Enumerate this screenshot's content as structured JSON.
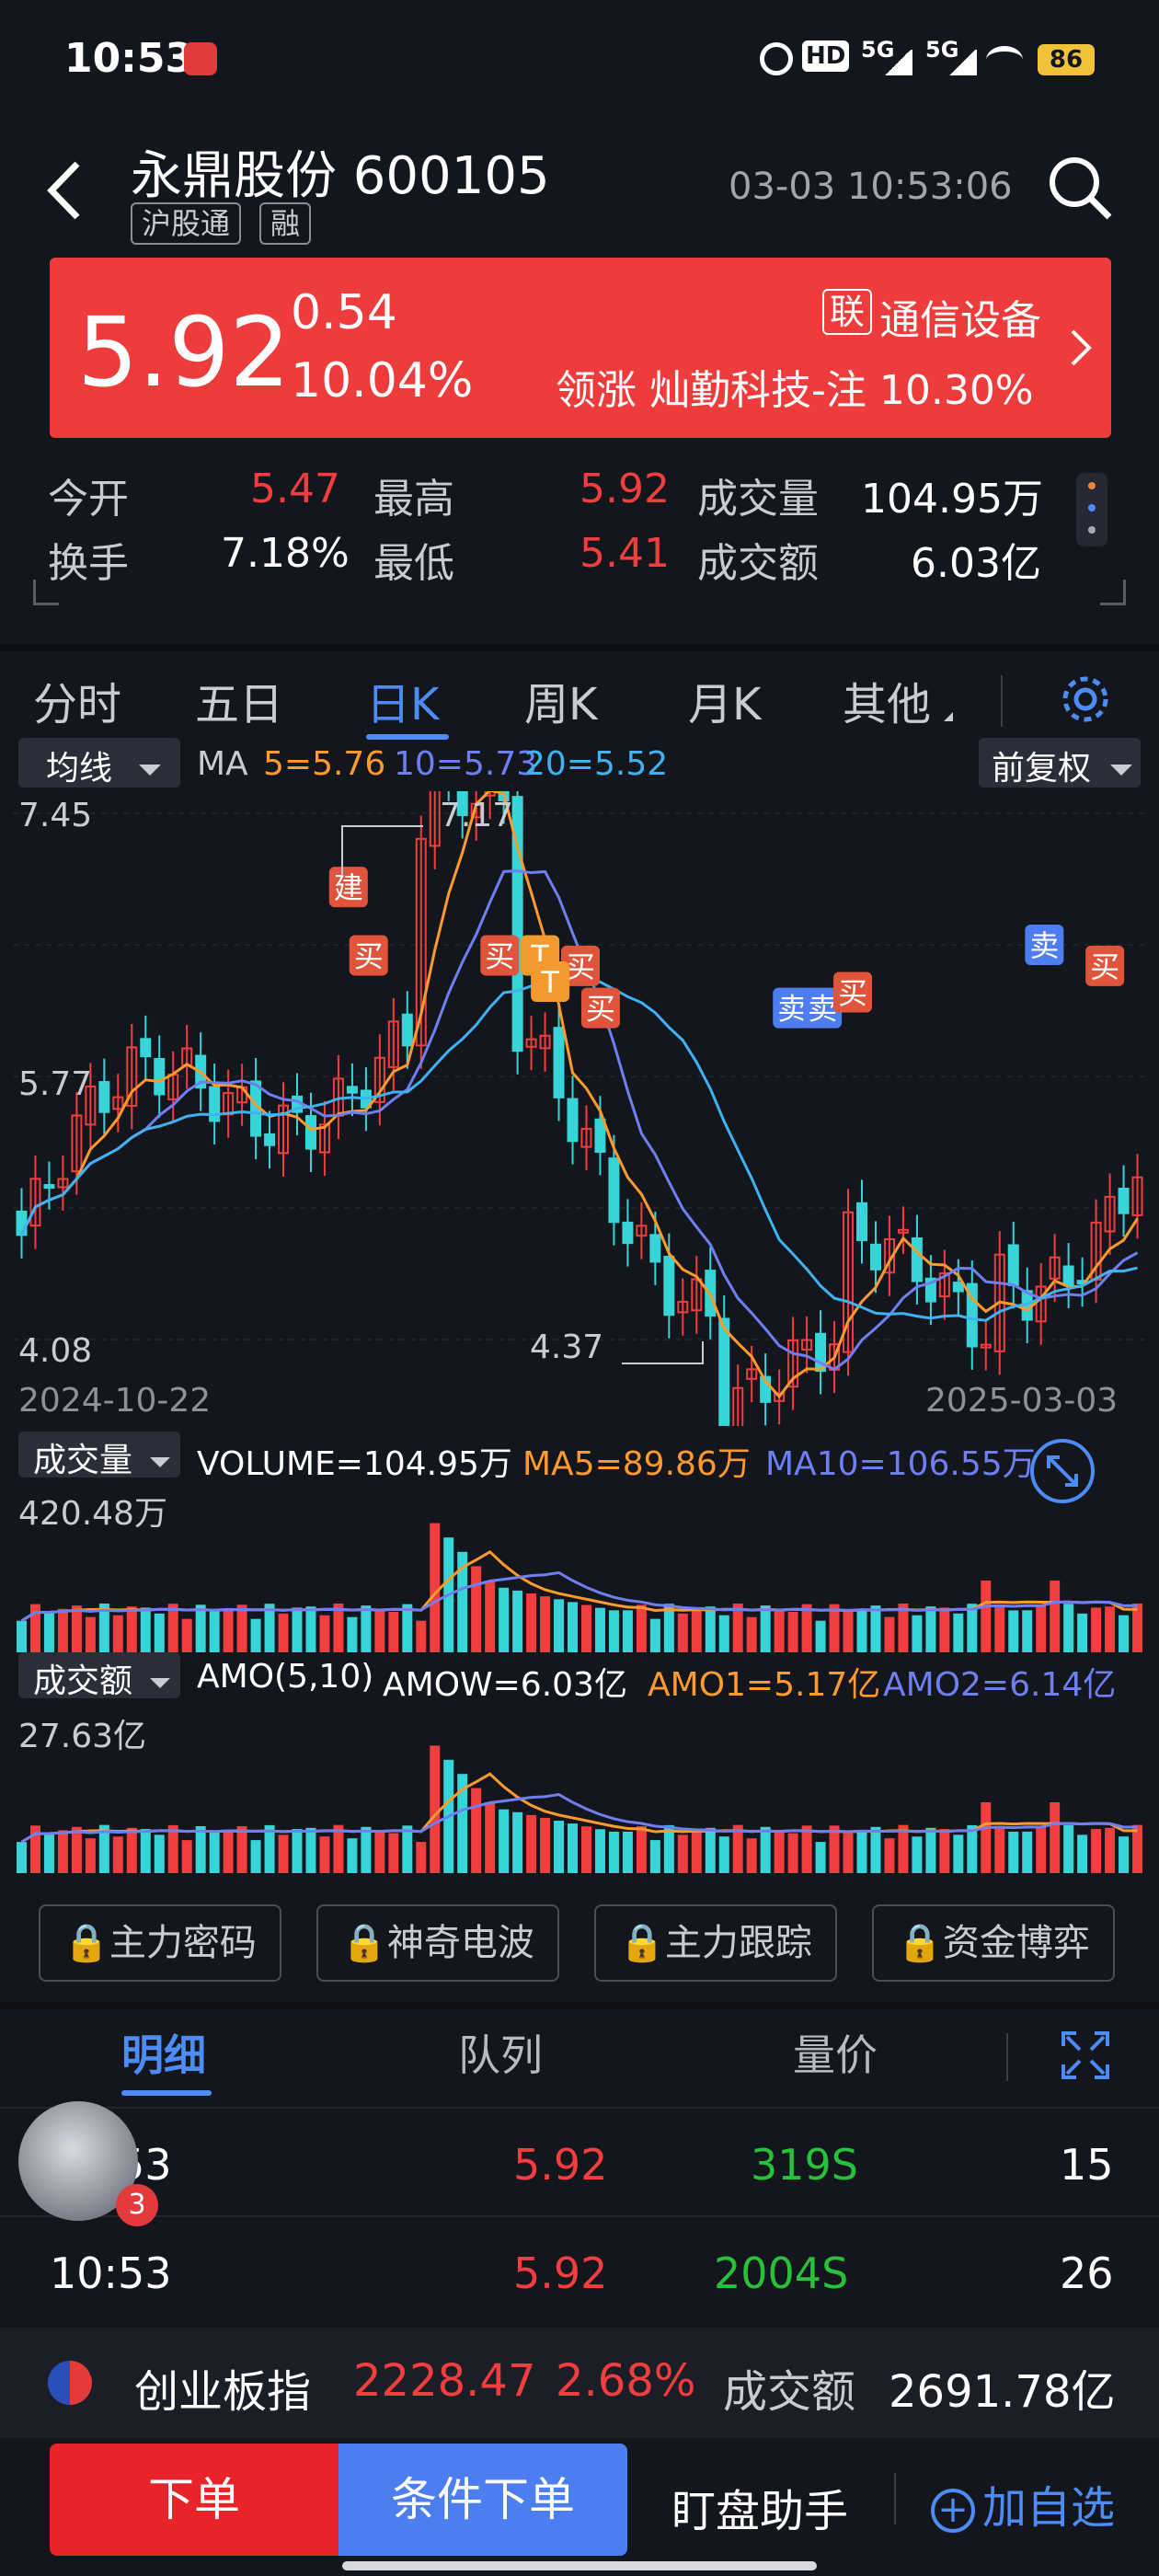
{
  "status": {
    "time": "10:53",
    "battery": "86",
    "net1": "5G",
    "net2": "5G"
  },
  "header": {
    "title": "永鼎股份 600105",
    "tag1": "沪股通",
    "tag2": "融",
    "datetime": "03-03 10:53:06"
  },
  "quote": {
    "price": "5.92",
    "change": "0.54",
    "change_pct": "10.04%",
    "sector_tag": "联",
    "sector": "通信设备",
    "leader": "领涨 灿勤科技-注 10.30%"
  },
  "stats": {
    "open_label": "今开",
    "open": "5.47",
    "high_label": "最高",
    "high": "5.92",
    "vol_label": "成交量",
    "vol": "104.95万",
    "turnover_label": "换手",
    "turnover": "7.18%",
    "low_label": "最低",
    "low": "5.41",
    "amt_label": "成交额",
    "amt": "6.03亿"
  },
  "tabs": [
    "分时",
    "五日",
    "日K",
    "周K",
    "月K",
    "其他"
  ],
  "active_tab": 2,
  "kline": {
    "ma_selector": "均线",
    "ma_label": "MA",
    "ma5": "5=5.76",
    "ma10": "10=5.73",
    "ma20": "20=5.52",
    "adjust": "前复权",
    "y_top": "7.45",
    "y_mid": "5.77",
    "y_bottom": "4.08",
    "max_note": "7.17",
    "min_note": "4.37",
    "date_start": "2024-10-22",
    "date_end": "2025-03-03",
    "marks": [
      "建",
      "买",
      "买",
      "T",
      "买",
      "T",
      "买",
      "卖",
      "卖",
      "买",
      "卖",
      "买"
    ]
  },
  "volume": {
    "selector": "成交量",
    "label": "VOLUME=104.95万",
    "ma5": "MA5=89.86万",
    "ma10": "MA10=106.55万",
    "y_top": "420.48万"
  },
  "amount": {
    "selector": "成交额",
    "label": "AMO(5,10)",
    "amow": "AMOW=6.03亿",
    "amo1": "AMO1=5.17亿",
    "amo2": "AMO2=6.14亿",
    "y_top": "27.63亿"
  },
  "lock_buttons": [
    "主力密码",
    "神奇电波",
    "主力跟踪",
    "资金博弈"
  ],
  "detail_tabs": [
    "明细",
    "队列",
    "量价"
  ],
  "trades": [
    {
      "time": "10:53",
      "price": "5.92",
      "vol": "319S",
      "n": "15"
    },
    {
      "time": "10:53",
      "price": "5.92",
      "vol": "2004S",
      "n": "26"
    }
  ],
  "ticker": {
    "name": "创业板指",
    "value": "2228.47",
    "pct": "2.68%",
    "amt_label": "成交额",
    "amt": "2691.78亿"
  },
  "bottom": {
    "order": "下单",
    "cond_order": "条件下单",
    "helper": "盯盘助手",
    "add_watch": "加自选"
  },
  "badge": "3",
  "colors": {
    "up": "#f23e3e",
    "down": "#38d5d8",
    "ma5": "#ff9a2e",
    "ma10": "#6f7ff2",
    "ma20": "#3fb2f2",
    "accent": "#4d8cf5"
  }
}
